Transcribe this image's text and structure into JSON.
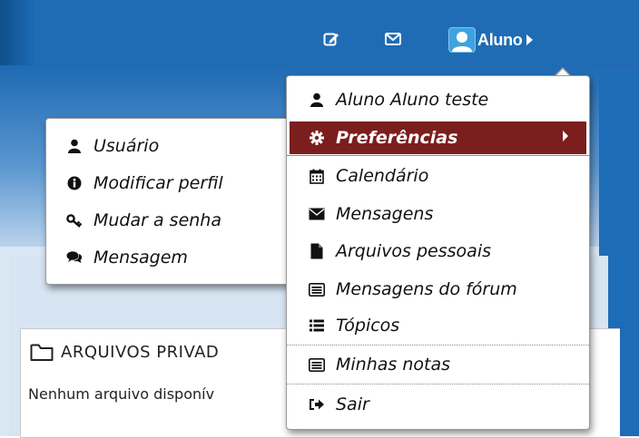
{
  "header": {
    "user_name": "Aluno",
    "icons": [
      "edit-icon",
      "envelope-icon",
      "user-avatar-icon"
    ]
  },
  "user_menu": {
    "items": [
      {
        "label": "Aluno Aluno teste",
        "icon": "user-icon"
      },
      {
        "label": "Preferências",
        "icon": "gear-icon",
        "active": true
      },
      {
        "label": "Calendário",
        "icon": "calendar-icon"
      },
      {
        "label": "Mensagens",
        "icon": "envelope-icon"
      },
      {
        "label": "Arquivos pessoais",
        "icon": "file-icon"
      },
      {
        "label": "Mensagens do fórum",
        "icon": "list-alt-icon"
      },
      {
        "label": "Tópicos",
        "icon": "list-icon"
      },
      {
        "label": "Minhas notas",
        "icon": "list-alt-icon"
      },
      {
        "label": "Sair",
        "icon": "sign-out-icon"
      }
    ]
  },
  "pref_submenu": {
    "items": [
      {
        "label": "Usuário",
        "icon": "user-icon"
      },
      {
        "label": "Modificar perfil",
        "icon": "info-icon"
      },
      {
        "label": "Mudar a senha",
        "icon": "key-icon"
      },
      {
        "label": "Mensagem",
        "icon": "comments-icon"
      }
    ]
  },
  "files_block": {
    "title": "ARQUIVOS PRIVAD",
    "empty_text": "Nenhum arquivo disponív"
  },
  "colors": {
    "header_blue": "#1f6cb5",
    "active_item": "#7b1f1e"
  }
}
